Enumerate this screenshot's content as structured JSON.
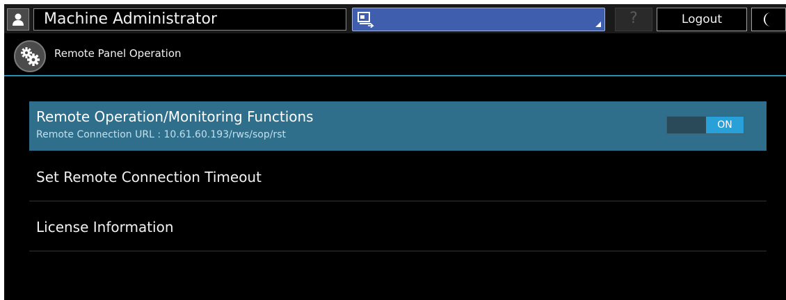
{
  "header": {
    "user_label": "Machine Administrator",
    "help_label": "?",
    "logout_label": "Logout",
    "icons": {
      "user": "user-icon",
      "screen_select": "screen-switch-icon",
      "night": "moon-icon"
    }
  },
  "title": {
    "text": "Remote Panel Operation",
    "icon": "gears-icon"
  },
  "list": {
    "items": [
      {
        "label": "Remote Operation/Monitoring Functions",
        "sublabel": "Remote Connection URL : 10.61.60.193/rws/sop/rst",
        "toggle_label": "ON",
        "selected": true
      },
      {
        "label": "Set Remote Connection Timeout"
      },
      {
        "label": "License Information"
      }
    ]
  },
  "colors": {
    "accent": "#2a8fb5",
    "selected_bg": "#2f6f8c",
    "toggle_on": "#2aa0d8",
    "select_bg": "#3f5fae"
  }
}
